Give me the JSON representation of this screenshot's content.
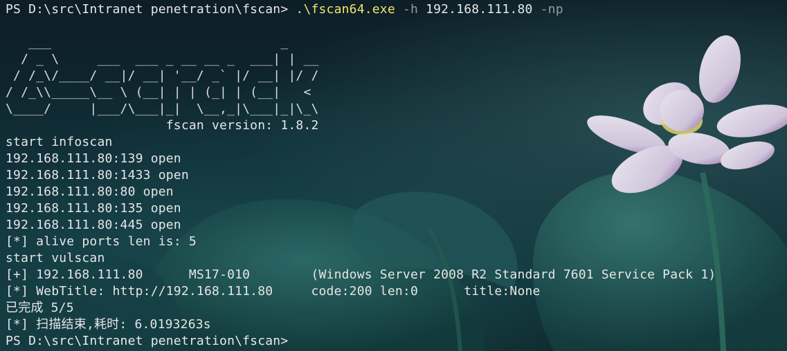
{
  "terminal": {
    "prompt_1": "PS D:\\src\\Intranet penetration\\fscan> ",
    "command": ".\\fscan64.exe",
    "flag_h": "-h",
    "target": "192.168.111.80",
    "flag_np": "-np",
    "banner": [
      "   ___                              _    ",
      "  / _ \\     ___  ___ _ __ __ _  ___| | __ ",
      " / /_\\/____/ __|/ __| '__/ _` |/ __| |/ /",
      "/ /_\\\\_____\\__ \\ (__| | | (_| | (__|   <    ",
      "\\____/     |___/\\___|_|  \\__,_|\\___|_|\\_\\   "
    ],
    "version_line": "                     fscan version: 1.8.2",
    "output": [
      "start infoscan",
      "192.168.111.80:139 open",
      "192.168.111.80:1433 open",
      "192.168.111.80:80 open",
      "192.168.111.80:135 open",
      "192.168.111.80:445 open",
      "[*] alive ports len is: 5",
      "start vulscan",
      "[+] 192.168.111.80      MS17-010        (Windows Server 2008 R2 Standard 7601 Service Pack 1)",
      "[*] WebTitle: http://192.168.111.80     code:200 len:0      title:None",
      "已完成 5/5",
      "[*] 扫描结束,耗时: 6.0193263s"
    ],
    "prompt_2": "PS D:\\src\\Intranet penetration\\fscan>"
  },
  "colors": {
    "command": "#f4e66a",
    "flag": "#9a9a9a",
    "text": "#e6e6e6"
  }
}
